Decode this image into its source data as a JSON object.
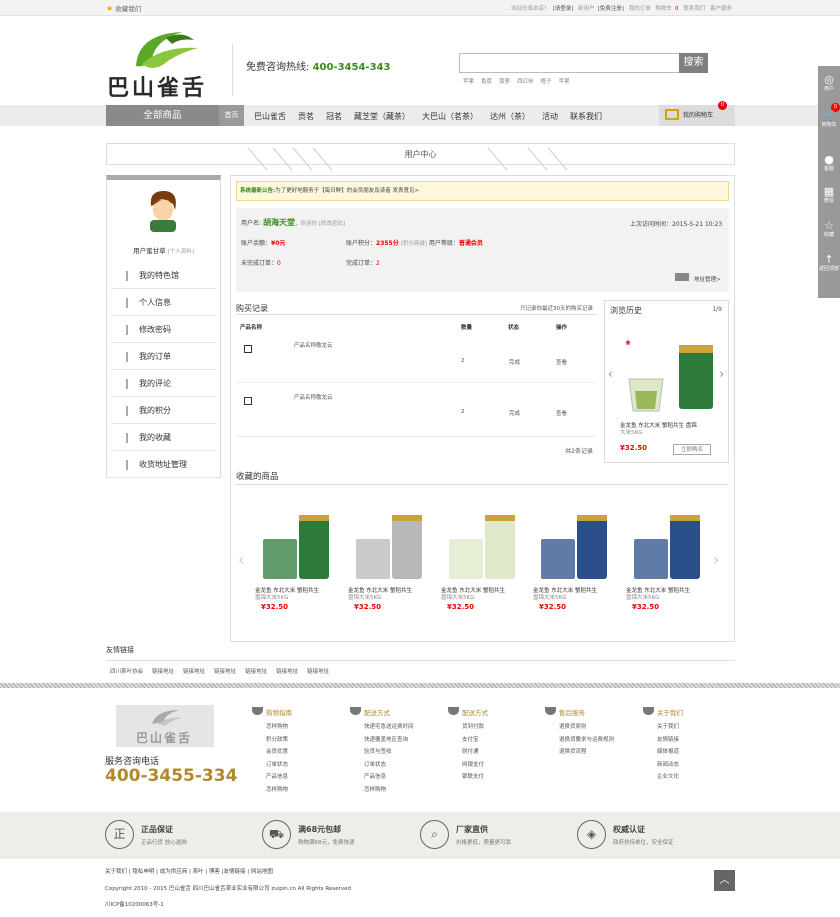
{
  "topbar": {
    "fav": "收藏我们",
    "links": [
      "欢迎光临本店！",
      "[请登录]",
      "新用户",
      "[免费注册]",
      "我的订单",
      "购物车",
      "0",
      "联系我们",
      "客户服务"
    ]
  },
  "header": {
    "logo_text": "巴山雀舌",
    "hotline_label": "免费咨询热线:",
    "hotline": "400-3454-343",
    "search_btn": "搜索",
    "hot_words": [
      "苹果",
      "香蕉",
      "菠萝",
      "西红柿",
      "橙子",
      "苹果"
    ]
  },
  "nav": {
    "all": "全部商品",
    "home": "首页",
    "items": [
      "巴山雀舌",
      "贡茗",
      "冠茗",
      "藏芝堂（藏茶）",
      "大巴山（茗茶）",
      "达州（茶）",
      "活动",
      "联系我们"
    ],
    "cart": "我的购物车",
    "cart_count": "0"
  },
  "uc_title": "用户中心",
  "sidebar": {
    "user": "用户蜜甘草",
    "profile": "[个人资料]",
    "menu": [
      "我的特色馆",
      "个人信息",
      "修改密码",
      "我的订单",
      "我的评论",
      "我的积分",
      "我的收藏",
      "收货地址管理"
    ]
  },
  "notice": {
    "label": "系统最新公告:",
    "text": "为了更好地服务于【每日鲜】的会员朋友及读者 发表意见>"
  },
  "info": {
    "name_label": "用户名:",
    "name": "胡海天堂",
    "welcome": "，欢迎你 [修改密码]",
    "last": "上次访问时间：2015-5-21 10:23",
    "balance_label": "账户余额：",
    "balance": "¥0元",
    "points_label": "账户积分：",
    "points": "2355分",
    "points_link": "[积分商城]",
    "level_label": "用户等级：",
    "level": "普通会员",
    "unfinished_label": "未完成订单：",
    "unfinished": "0",
    "finished_label": "完成订单：",
    "finished": "2",
    "address": "地址管理>"
  },
  "buy": {
    "title": "购买记录",
    "note": "只记录你最近30天的购买记录",
    "headers": [
      "产品名称",
      "数量",
      "状态",
      "操作"
    ],
    "rows": [
      {
        "name": "产品名称敬龙云",
        "qty": "2",
        "status": "完成",
        "op": "查看"
      },
      {
        "name": "产品名称敬龙云",
        "qty": "2",
        "status": "完成",
        "op": "查看"
      }
    ],
    "total": "共2条记录"
  },
  "history": {
    "title": "浏览历史",
    "page": "1/9",
    "name": "金龙鱼 东北大米 蟹稻共生 盘锦",
    "sub": "大米5KG",
    "price": "¥32.50",
    "btn": "立即购买",
    "arrow_prev": "‹",
    "arrow_next": "›"
  },
  "fav": {
    "title": "收藏的商品",
    "arrow_prev": "‹",
    "arrow_next": "›",
    "items": [
      {
        "n": "金龙鱼 东北大米 蟹稻共生",
        "s": "盘锦大米5KG",
        "p": "¥32.50"
      },
      {
        "n": "金龙鱼 东北大米 蟹稻共生",
        "s": "盘锦大米5KG",
        "p": "¥32.50"
      },
      {
        "n": "金龙鱼 东北大米 蟹稻共生",
        "s": "盘锦大米5KG",
        "p": "¥32.50"
      },
      {
        "n": "金龙鱼 东北大米 蟹稻共生",
        "s": "盘锦大米5KG",
        "p": "¥32.50"
      },
      {
        "n": "金龙鱼 东北大米 蟹稻共生",
        "s": "盘锦大米5KG",
        "p": "¥32.50"
      }
    ]
  },
  "links": {
    "title": "友情链接",
    "items": [
      "四川茶叶协会",
      "链接地址",
      "链接地址",
      "链接地址",
      "链接地址",
      "链接地址",
      "链接地址"
    ]
  },
  "footer": {
    "logo_text": "巴山雀舌",
    "tel_label": "服务咨询电话",
    "tel": "400-3455-334",
    "cols": [
      {
        "h": "购物指南",
        "items": [
          "怎样购物",
          "积分政策",
          "会员优惠",
          "订单状态",
          "产品信息",
          "怎样购物"
        ]
      },
      {
        "h": "配送方式",
        "items": [
          "快递宅急送运费时间",
          "快递覆盖地区查询",
          "验货与签收",
          "订单状态",
          "产品信息",
          "怎样购物"
        ]
      },
      {
        "h": "配送方式",
        "items": [
          "货到付款",
          "支付宝",
          "财付通",
          "网银支付",
          "银联支付"
        ]
      },
      {
        "h": "售后服务",
        "items": [
          "退换货原则",
          "退换货要求与运费规则",
          "退换货流程"
        ]
      },
      {
        "h": "关于我们",
        "items": [
          "关于我们",
          "友情链接",
          "媒体报道",
          "新闻动态",
          "企业文化"
        ]
      }
    ],
    "guarantees": [
      {
        "icon": "正",
        "t": "正品保证",
        "s": "正品行货 放心选购"
      },
      {
        "icon": "⛟",
        "t": "满68元包邮",
        "s": "购物满68元，免费快递"
      },
      {
        "icon": "⌕",
        "t": "厂家直供",
        "s": "价格更低，质量更可靠"
      },
      {
        "icon": "◈",
        "t": "权威认证",
        "s": "政府扶持单位，安全保证"
      }
    ],
    "bottom_links": "关于我们 | 隐私申明 | 成为供应商 | 茶叶 | 博客 |友情链接 | 网站地图",
    "copyright": "Copyright 2010 - 2015 巴山雀舌 四川巴山雀舌茶业实业有限公司 zuipin.cn All Rights Reserved",
    "icp": "川ICP备10200063号-1",
    "totop": "︿"
  },
  "sidebar_float": [
    {
      "i": "◎",
      "l": "用户"
    },
    {
      "i": "🛒",
      "l": "购物车"
    },
    {
      "i": "●",
      "l": "客服"
    },
    {
      "i": "▦",
      "l": "微信"
    },
    {
      "i": "☆",
      "l": "收藏"
    },
    {
      "i": "↑",
      "l": "返回顶部"
    }
  ],
  "sidebar_float_badge": "0"
}
